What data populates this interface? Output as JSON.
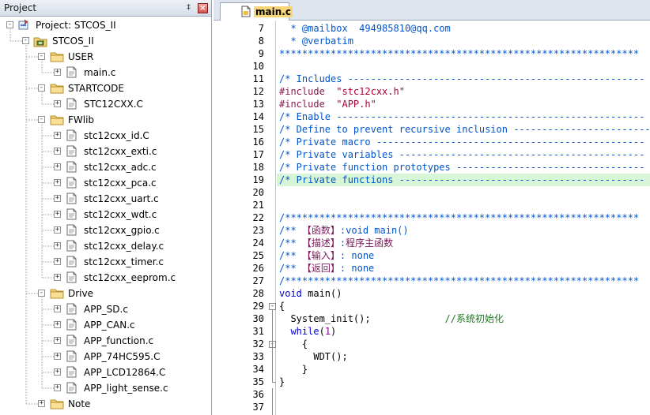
{
  "project_panel": {
    "title": "Project",
    "pin_glyph": "‡",
    "close_glyph": "×",
    "tree": [
      {
        "label": "Project: STCOS_II",
        "icon": "project-icon",
        "toggle": "-"
      },
      {
        "label": "STCOS_II",
        "icon": "target-icon",
        "toggle": "-"
      },
      {
        "label": "USER",
        "icon": "folder-icon",
        "toggle": "-"
      },
      {
        "label": "main.c",
        "icon": "file-icon",
        "toggle": "+"
      },
      {
        "label": "STARTCODE",
        "icon": "folder-icon",
        "toggle": "-"
      },
      {
        "label": "STC12CXX.C",
        "icon": "file-icon",
        "toggle": "+"
      },
      {
        "label": "FWlib",
        "icon": "folder-icon",
        "toggle": "-"
      },
      {
        "label": "stc12cxx_id.C",
        "icon": "file-icon",
        "toggle": "+"
      },
      {
        "label": "stc12cxx_exti.c",
        "icon": "file-icon",
        "toggle": "+"
      },
      {
        "label": "stc12cxx_adc.c",
        "icon": "file-icon",
        "toggle": "+"
      },
      {
        "label": "stc12cxx_pca.c",
        "icon": "file-icon",
        "toggle": "+"
      },
      {
        "label": "stc12cxx_uart.c",
        "icon": "file-icon",
        "toggle": "+"
      },
      {
        "label": "stc12cxx_wdt.c",
        "icon": "file-icon",
        "toggle": "+"
      },
      {
        "label": "stc12cxx_gpio.c",
        "icon": "file-icon",
        "toggle": "+"
      },
      {
        "label": "stc12cxx_delay.c",
        "icon": "file-icon",
        "toggle": "+"
      },
      {
        "label": "stc12cxx_timer.c",
        "icon": "file-icon",
        "toggle": "+"
      },
      {
        "label": "stc12cxx_eeprom.c",
        "icon": "file-icon",
        "toggle": "+"
      },
      {
        "label": "Drive",
        "icon": "folder-icon",
        "toggle": "-"
      },
      {
        "label": "APP_SD.c",
        "icon": "file-icon",
        "toggle": "+"
      },
      {
        "label": "APP_CAN.c",
        "icon": "file-icon",
        "toggle": "+"
      },
      {
        "label": "APP_function.c",
        "icon": "file-icon",
        "toggle": "+"
      },
      {
        "label": "APP_74HC595.C",
        "icon": "file-icon",
        "toggle": "+"
      },
      {
        "label": "APP_LCD12864.C",
        "icon": "file-icon",
        "toggle": "+"
      },
      {
        "label": "APP_light_sense.c",
        "icon": "file-icon",
        "toggle": "+"
      },
      {
        "label": "Note",
        "icon": "folder-icon",
        "toggle": "+"
      }
    ]
  },
  "editor": {
    "tab_label": "main.c",
    "highlight_color": "#d8f5d8",
    "lines": [
      {
        "n": "7",
        "parts": [
          {
            "c": "c-comment",
            "t": "  * @mailbox  494985810@qq.com"
          }
        ]
      },
      {
        "n": "8",
        "parts": [
          {
            "c": "c-comment",
            "t": "  * @verbatim"
          }
        ]
      },
      {
        "n": "9",
        "parts": [
          {
            "c": "c-comment",
            "t": "***************************************************************"
          }
        ]
      },
      {
        "n": "10",
        "parts": []
      },
      {
        "n": "11",
        "parts": [
          {
            "c": "c-comment",
            "t": "/* Includes ----------------------------------------------------"
          }
        ]
      },
      {
        "n": "12",
        "parts": [
          {
            "c": "c-pp",
            "t": "#include "
          },
          {
            "c": "c-str",
            "t": " \"stc12cxx.h\""
          }
        ]
      },
      {
        "n": "13",
        "parts": [
          {
            "c": "c-pp",
            "t": "#include "
          },
          {
            "c": "c-str",
            "t": " \"APP.h\""
          }
        ]
      },
      {
        "n": "14",
        "parts": [
          {
            "c": "c-comment",
            "t": "/* Enable ------------------------------------------------------"
          }
        ]
      },
      {
        "n": "15",
        "parts": [
          {
            "c": "c-comment",
            "t": "/* Define to prevent recursive inclusion ------------------------"
          }
        ]
      },
      {
        "n": "16",
        "parts": [
          {
            "c": "c-comment",
            "t": "/* Private macro -----------------------------------------------"
          }
        ]
      },
      {
        "n": "17",
        "parts": [
          {
            "c": "c-comment",
            "t": "/* Private variables -------------------------------------------"
          }
        ]
      },
      {
        "n": "18",
        "parts": [
          {
            "c": "c-comment",
            "t": "/* Private function prototypes ---------------------------------"
          }
        ]
      },
      {
        "n": "19",
        "hl": true,
        "parts": [
          {
            "c": "c-comment",
            "t": "/* Private functions -------------------------------------------"
          }
        ]
      },
      {
        "n": "20",
        "parts": []
      },
      {
        "n": "21",
        "parts": []
      },
      {
        "n": "22",
        "parts": [
          {
            "c": "c-comment",
            "t": "/**************************************************************"
          }
        ]
      },
      {
        "n": "23",
        "parts": [
          {
            "c": "c-comment",
            "t": "/** "
          },
          {
            "c": "c-zh",
            "t": "【函数】"
          },
          {
            "c": "c-comment",
            "t": ":void main()"
          }
        ]
      },
      {
        "n": "24",
        "parts": [
          {
            "c": "c-comment",
            "t": "/** "
          },
          {
            "c": "c-zh",
            "t": "【描述】"
          },
          {
            "c": "c-comment",
            "t": ":"
          },
          {
            "c": "c-zh",
            "t": "程序主函数"
          }
        ]
      },
      {
        "n": "25",
        "parts": [
          {
            "c": "c-comment",
            "t": "/** "
          },
          {
            "c": "c-zh",
            "t": "【输入】"
          },
          {
            "c": "c-comment",
            "t": ": none"
          }
        ]
      },
      {
        "n": "26",
        "parts": [
          {
            "c": "c-comment",
            "t": "/** "
          },
          {
            "c": "c-zh",
            "t": "【返回】"
          },
          {
            "c": "c-comment",
            "t": ": none"
          }
        ]
      },
      {
        "n": "27",
        "parts": [
          {
            "c": "c-comment",
            "t": "/**************************************************************"
          }
        ]
      },
      {
        "n": "28",
        "parts": [
          {
            "c": "c-kw",
            "t": "void"
          },
          {
            "c": "c-txt",
            "t": " main()"
          }
        ]
      },
      {
        "n": "29",
        "fold": "-",
        "parts": [
          {
            "c": "c-txt",
            "t": "{"
          }
        ]
      },
      {
        "n": "30",
        "parts": [
          {
            "c": "c-txt",
            "t": "  System_init();             "
          },
          {
            "c": "c-cmt2",
            "t": "//系统初始化"
          }
        ]
      },
      {
        "n": "31",
        "parts": [
          {
            "c": "c-kw",
            "t": "  while"
          },
          {
            "c": "c-txt",
            "t": "("
          },
          {
            "c": "c-num",
            "t": "1"
          },
          {
            "c": "c-txt",
            "t": ")"
          }
        ]
      },
      {
        "n": "32",
        "fold": "-",
        "parts": [
          {
            "c": "c-txt",
            "t": "    {"
          }
        ]
      },
      {
        "n": "33",
        "parts": [
          {
            "c": "c-txt",
            "t": "      WDT();"
          }
        ]
      },
      {
        "n": "34",
        "parts": [
          {
            "c": "c-txt",
            "t": "    }"
          }
        ]
      },
      {
        "n": "35",
        "parts": [
          {
            "c": "c-txt",
            "t": "}"
          }
        ]
      },
      {
        "n": "36",
        "parts": []
      },
      {
        "n": "37",
        "parts": []
      }
    ]
  }
}
